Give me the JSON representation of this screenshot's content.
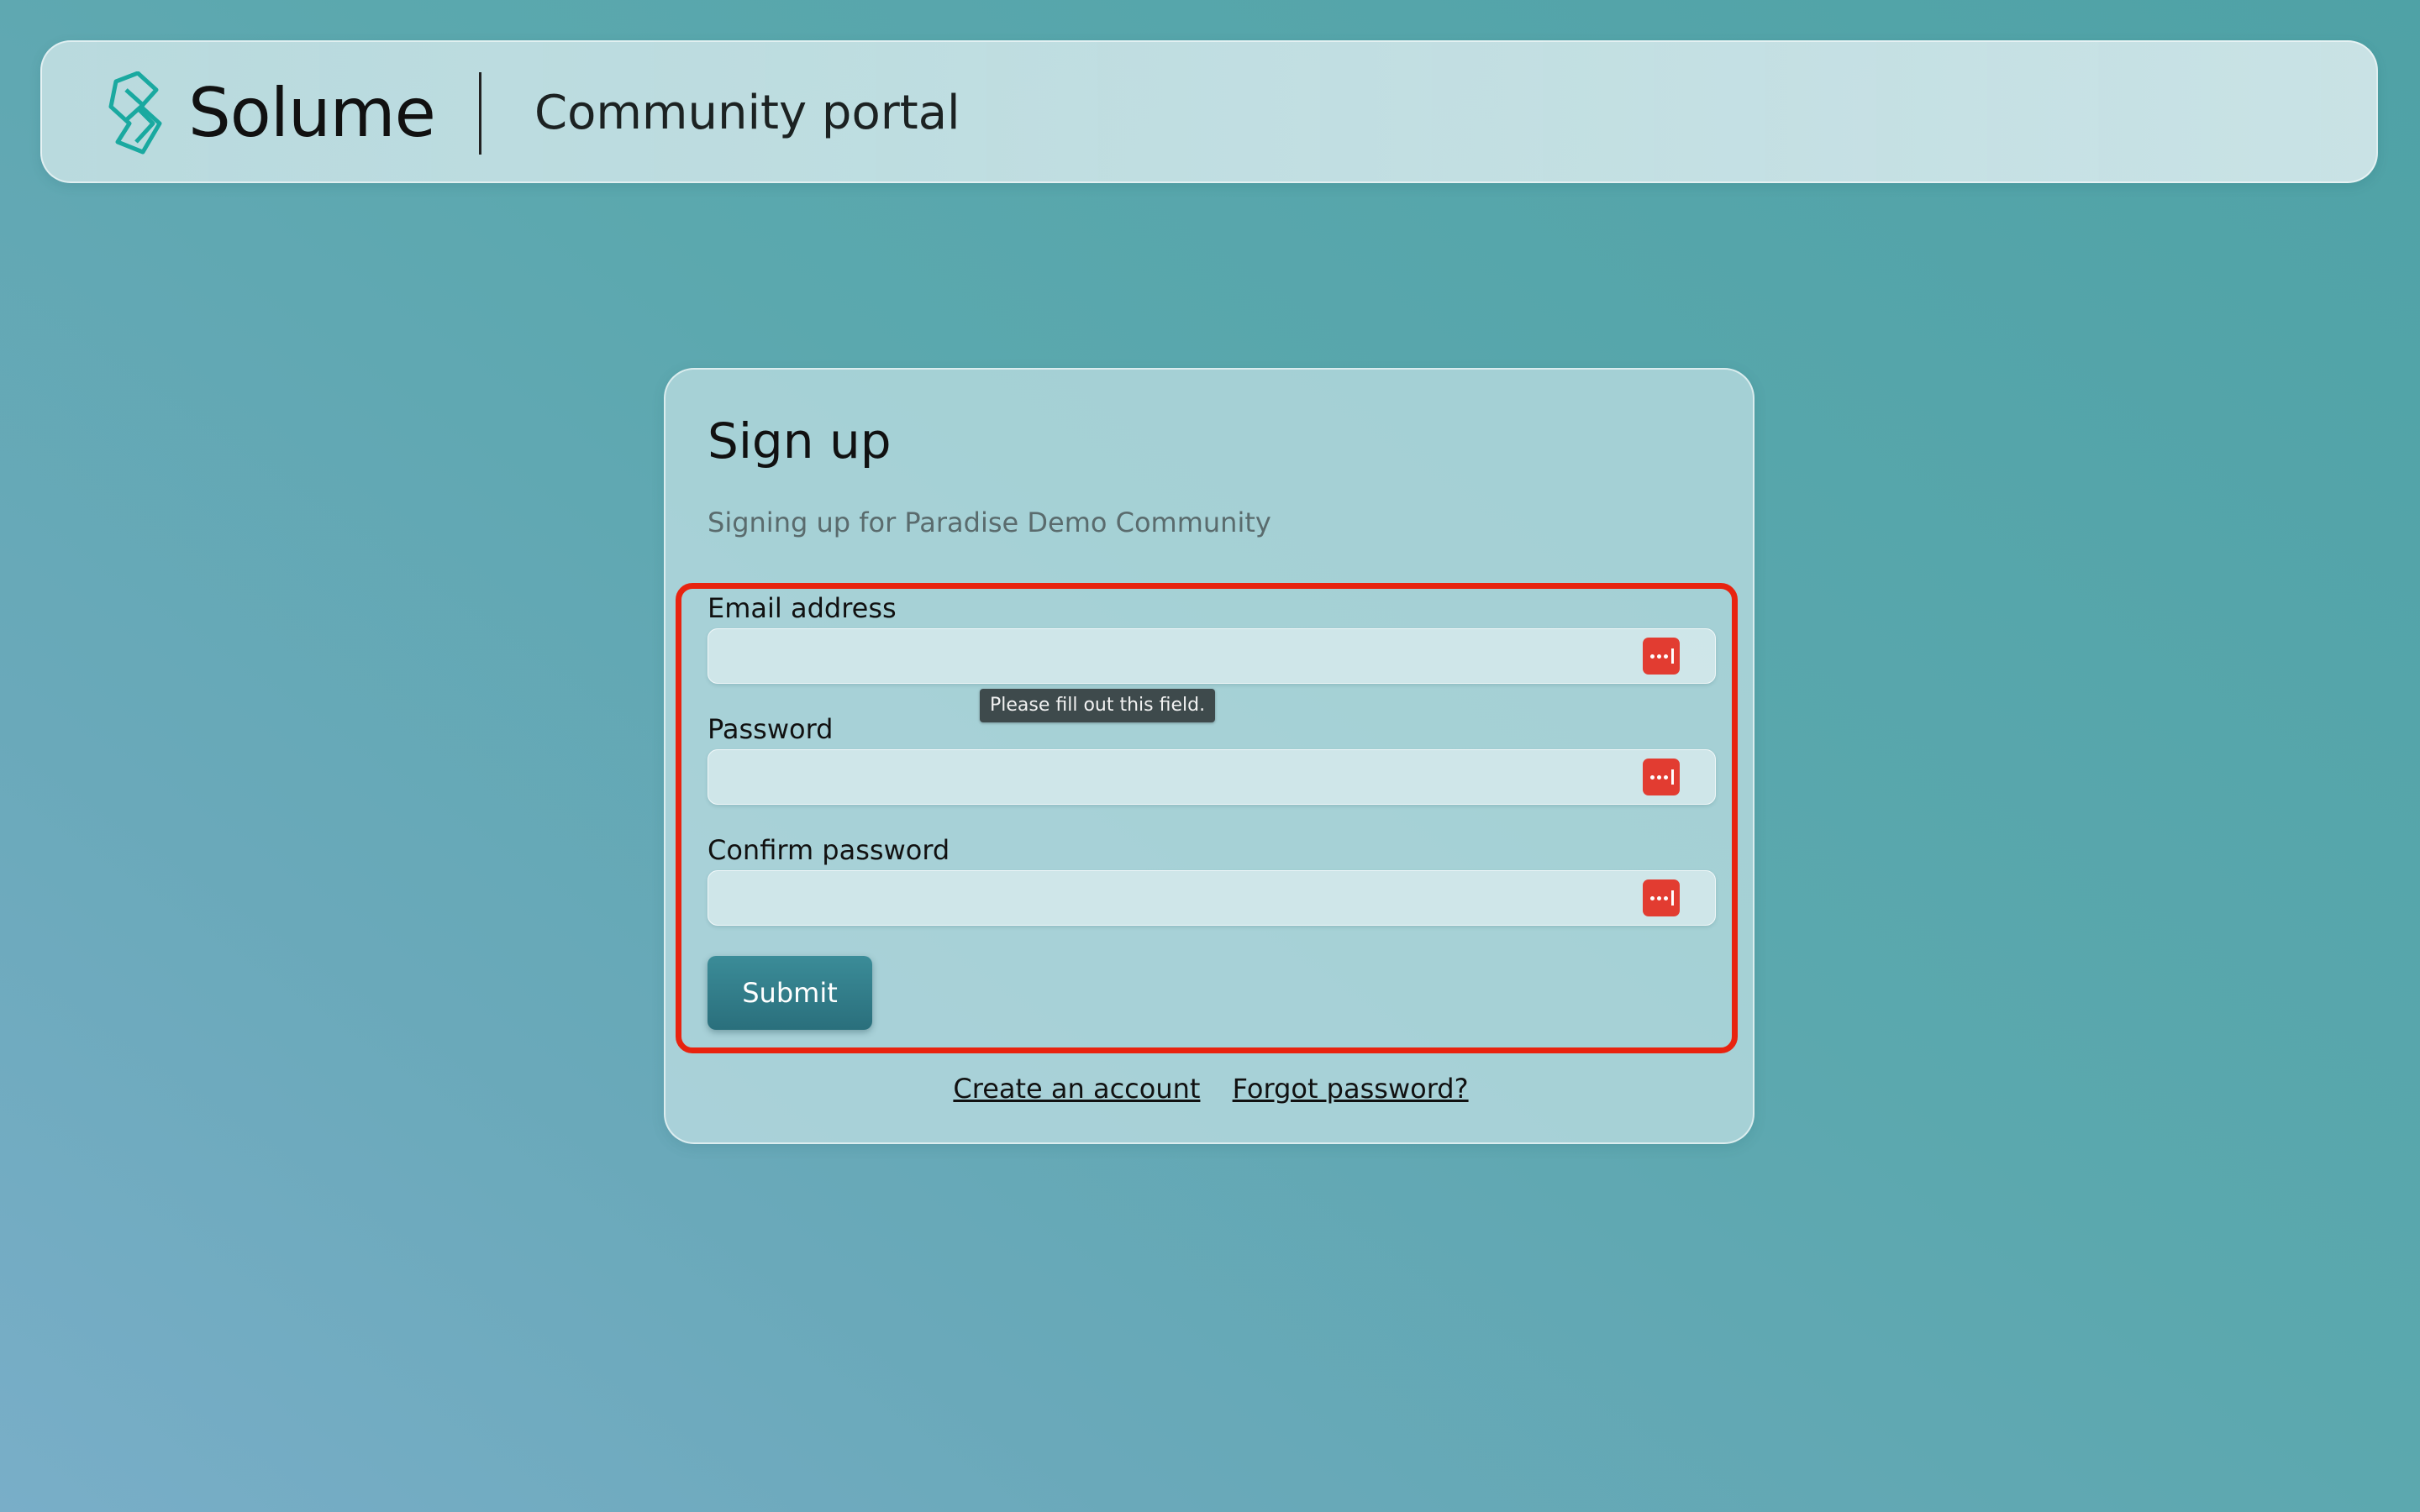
{
  "header": {
    "brand": "Solume",
    "portal_title": "Community portal",
    "logo_icon": "solume-logo-icon",
    "brand_color": "#1aa9a0"
  },
  "form": {
    "title": "Sign up",
    "subtitle": "Signing up for Paradise Demo Community",
    "fields": [
      {
        "label": "Email address",
        "value": "",
        "icon": "password-manager-key-icon"
      },
      {
        "label": "Password",
        "value": "",
        "icon": "password-manager-key-icon"
      },
      {
        "label": "Confirm password",
        "value": "",
        "icon": "password-manager-key-icon"
      }
    ],
    "validation_tooltip": "Please fill out this field.",
    "submit_label": "Submit",
    "submit_color": "#2f7d89",
    "highlight_color": "#e8230f"
  },
  "links": {
    "create_account": "Create an account",
    "forgot_password": "Forgot password?"
  }
}
